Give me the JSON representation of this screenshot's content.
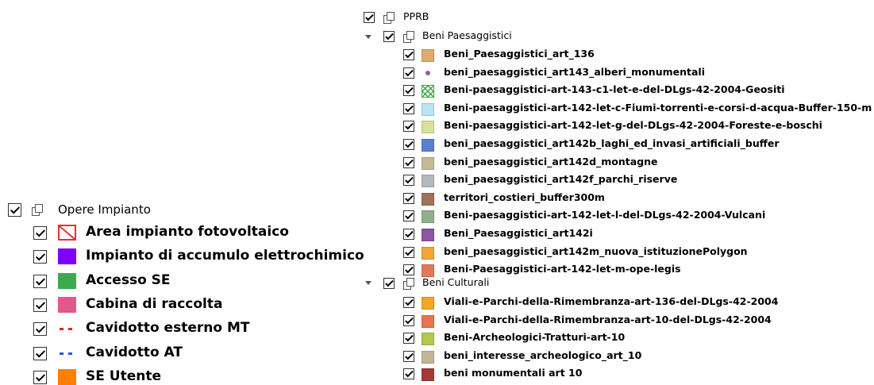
{
  "pprb": {
    "label": "PPRB",
    "beni_paesaggistici": {
      "label": "Beni Paesaggistici",
      "items": [
        {
          "label": "Beni_Paesaggistici_art_136",
          "color": "#e0a96d",
          "symbol": "fill"
        },
        {
          "label": "beni_paesaggistici_art143_alberi_monumentali",
          "color": "#8e5fa8",
          "symbol": "point"
        },
        {
          "label": "Beni-paesaggistici-art-143-c1-let-e-del-DLgs-42-2004-Geositi",
          "color": "#3aa845",
          "symbol": "hatch"
        },
        {
          "label": "Beni-paesaggistici-art-142-let-c-Fiumi-torrenti-e-corsi-d-acqua-Buffer-150-m",
          "color": "#b9e3f7",
          "symbol": "fill"
        },
        {
          "label": "Beni-paesaggistici-art-142-let-g-del-DLgs-42-2004-Foreste-e-boschi",
          "color": "#d6e29b",
          "symbol": "fill"
        },
        {
          "label": "beni_paesaggistici_art142b_laghi_ed_invasi_artificiali_buffer",
          "color": "#5a7ed4",
          "symbol": "fill"
        },
        {
          "label": "beni_paesaggistici_art142d_montagne",
          "color": "#c4b99b",
          "symbol": "fill"
        },
        {
          "label": "beni_paesaggistici_art142f_parchi_riserve",
          "color": "#b2b9bf",
          "symbol": "fill"
        },
        {
          "label": "territori_costieri_buffer300m",
          "color": "#a0725a",
          "symbol": "fill"
        },
        {
          "label": "Beni-paesaggistici-art-142-let-l-del-DLgs-42-2004-Vulcani",
          "color": "#8fb08b",
          "symbol": "fill"
        },
        {
          "label": "Beni_Paesaggistici_art142i",
          "color": "#8c55a0",
          "symbol": "fill"
        },
        {
          "label": "beni_paesaggistici_art142m_nuova_istituzionePolygon",
          "color": "#f4a534",
          "symbol": "fill"
        },
        {
          "label": "Beni-Paesaggistici-art-142-let-m-ope-legis",
          "color": "#e0785a",
          "symbol": "fill"
        }
      ]
    },
    "beni_culturali": {
      "label": "Beni Culturali",
      "items": [
        {
          "label": "Viali-e-Parchi-della-Rimembranza-art-136-del-DLgs-42-2004",
          "color": "#f5a623",
          "symbol": "fill"
        },
        {
          "label": "Viali-e-Parchi-della-Rimembranza-art-10-del-DLgs-42-2004",
          "color": "#e8744f",
          "symbol": "fill"
        },
        {
          "label": "Beni-Archeologici-Tratturi-art-10",
          "color": "#b5c64a",
          "symbol": "fill"
        },
        {
          "label": "beni_interesse_archeologico_art_10",
          "color": "#c2b59b",
          "symbol": "fill"
        },
        {
          "label": "beni monumentali art 10",
          "color": "#a33b35",
          "symbol": "fill"
        }
      ]
    }
  },
  "opere_impianto": {
    "label": "Opere Impianto",
    "items": [
      {
        "label": "Area impianto fotovoltaico",
        "color": "#e8302f",
        "symbol": "hatched-outline"
      },
      {
        "label": "Impianto di accumulo elettrochimico",
        "color": "#8000ff",
        "symbol": "fill"
      },
      {
        "label": "Accesso SE",
        "color": "#3dab4d",
        "symbol": "fill"
      },
      {
        "label": "Cabina di raccolta",
        "color": "#de5a8a",
        "symbol": "fill"
      },
      {
        "label": "Cavidotto esterno MT",
        "color": "#e8201c",
        "symbol": "dashed-line"
      },
      {
        "label": "Cavidotto AT",
        "color": "#2b4ff0",
        "symbol": "dashed-line"
      },
      {
        "label": "SE Utente",
        "color": "#ff7f00",
        "symbol": "fill"
      }
    ]
  }
}
